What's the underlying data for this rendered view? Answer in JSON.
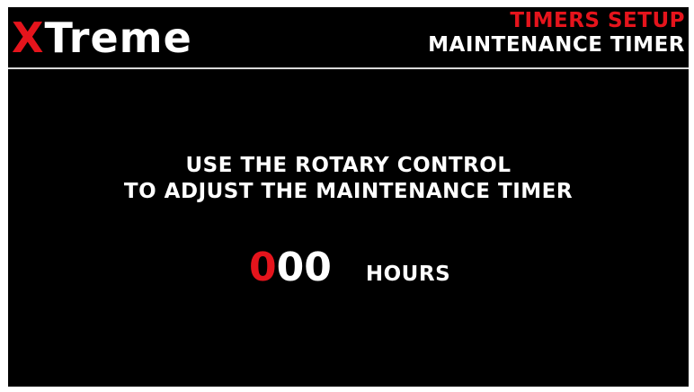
{
  "header": {
    "brand_x": "X",
    "brand_rest": "Treme",
    "section_title": "TIMERS SETUP",
    "page_title": "MAINTENANCE TIMER"
  },
  "instructions": {
    "line1": "USE THE ROTARY CONTROL",
    "line2": "TO ADJUST THE MAINTENANCE TIMER"
  },
  "timer": {
    "digits": [
      "0",
      "0",
      "0"
    ],
    "active_digit_index": 0,
    "unit": "HOURS"
  },
  "colors": {
    "background": "#000000",
    "accent": "#e5141c",
    "text": "#ffffff"
  }
}
